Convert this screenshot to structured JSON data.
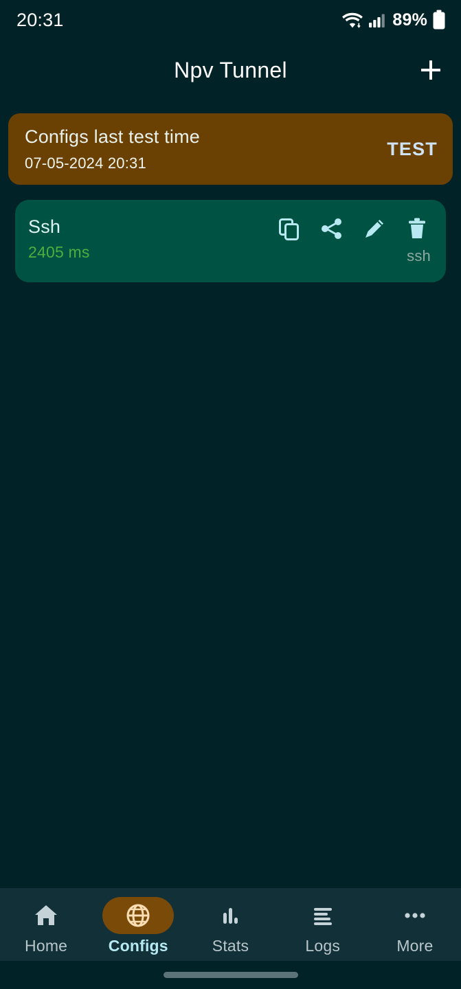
{
  "status_bar": {
    "clock": "20:31",
    "battery_percent": "89%",
    "wifi_icon": "wifi-icon",
    "signal_icon": "cellular-signal-icon",
    "battery_icon": "battery-icon"
  },
  "app_bar": {
    "title": "Npv Tunnel",
    "add_label": "+",
    "add_icon": "plus-icon"
  },
  "test_banner": {
    "title": "Configs last test time",
    "timestamp": "07-05-2024 20:31",
    "action_label": "TEST",
    "bg_color": "#6b4003"
  },
  "configs": [
    {
      "name": "Ssh",
      "ping": "2405 ms",
      "protocol": "ssh",
      "bg_color": "#005343",
      "ping_color": "#4eae3e",
      "actions": [
        {
          "name": "copy-icon",
          "label": "Copy"
        },
        {
          "name": "share-icon",
          "label": "Share"
        },
        {
          "name": "edit-icon",
          "label": "Edit"
        },
        {
          "name": "delete-icon",
          "label": "Delete"
        }
      ]
    }
  ],
  "bottom_nav": {
    "active_index": 1,
    "active_pill_color": "#7a4a08",
    "items": [
      {
        "label": "Home",
        "icon": "home-icon"
      },
      {
        "label": "Configs",
        "icon": "globe-icon"
      },
      {
        "label": "Stats",
        "icon": "bar-chart-icon"
      },
      {
        "label": "Logs",
        "icon": "list-lines-icon"
      },
      {
        "label": "More",
        "icon": "more-dots-icon"
      }
    ]
  },
  "gesture_bar": {
    "color": "#5b7379"
  }
}
